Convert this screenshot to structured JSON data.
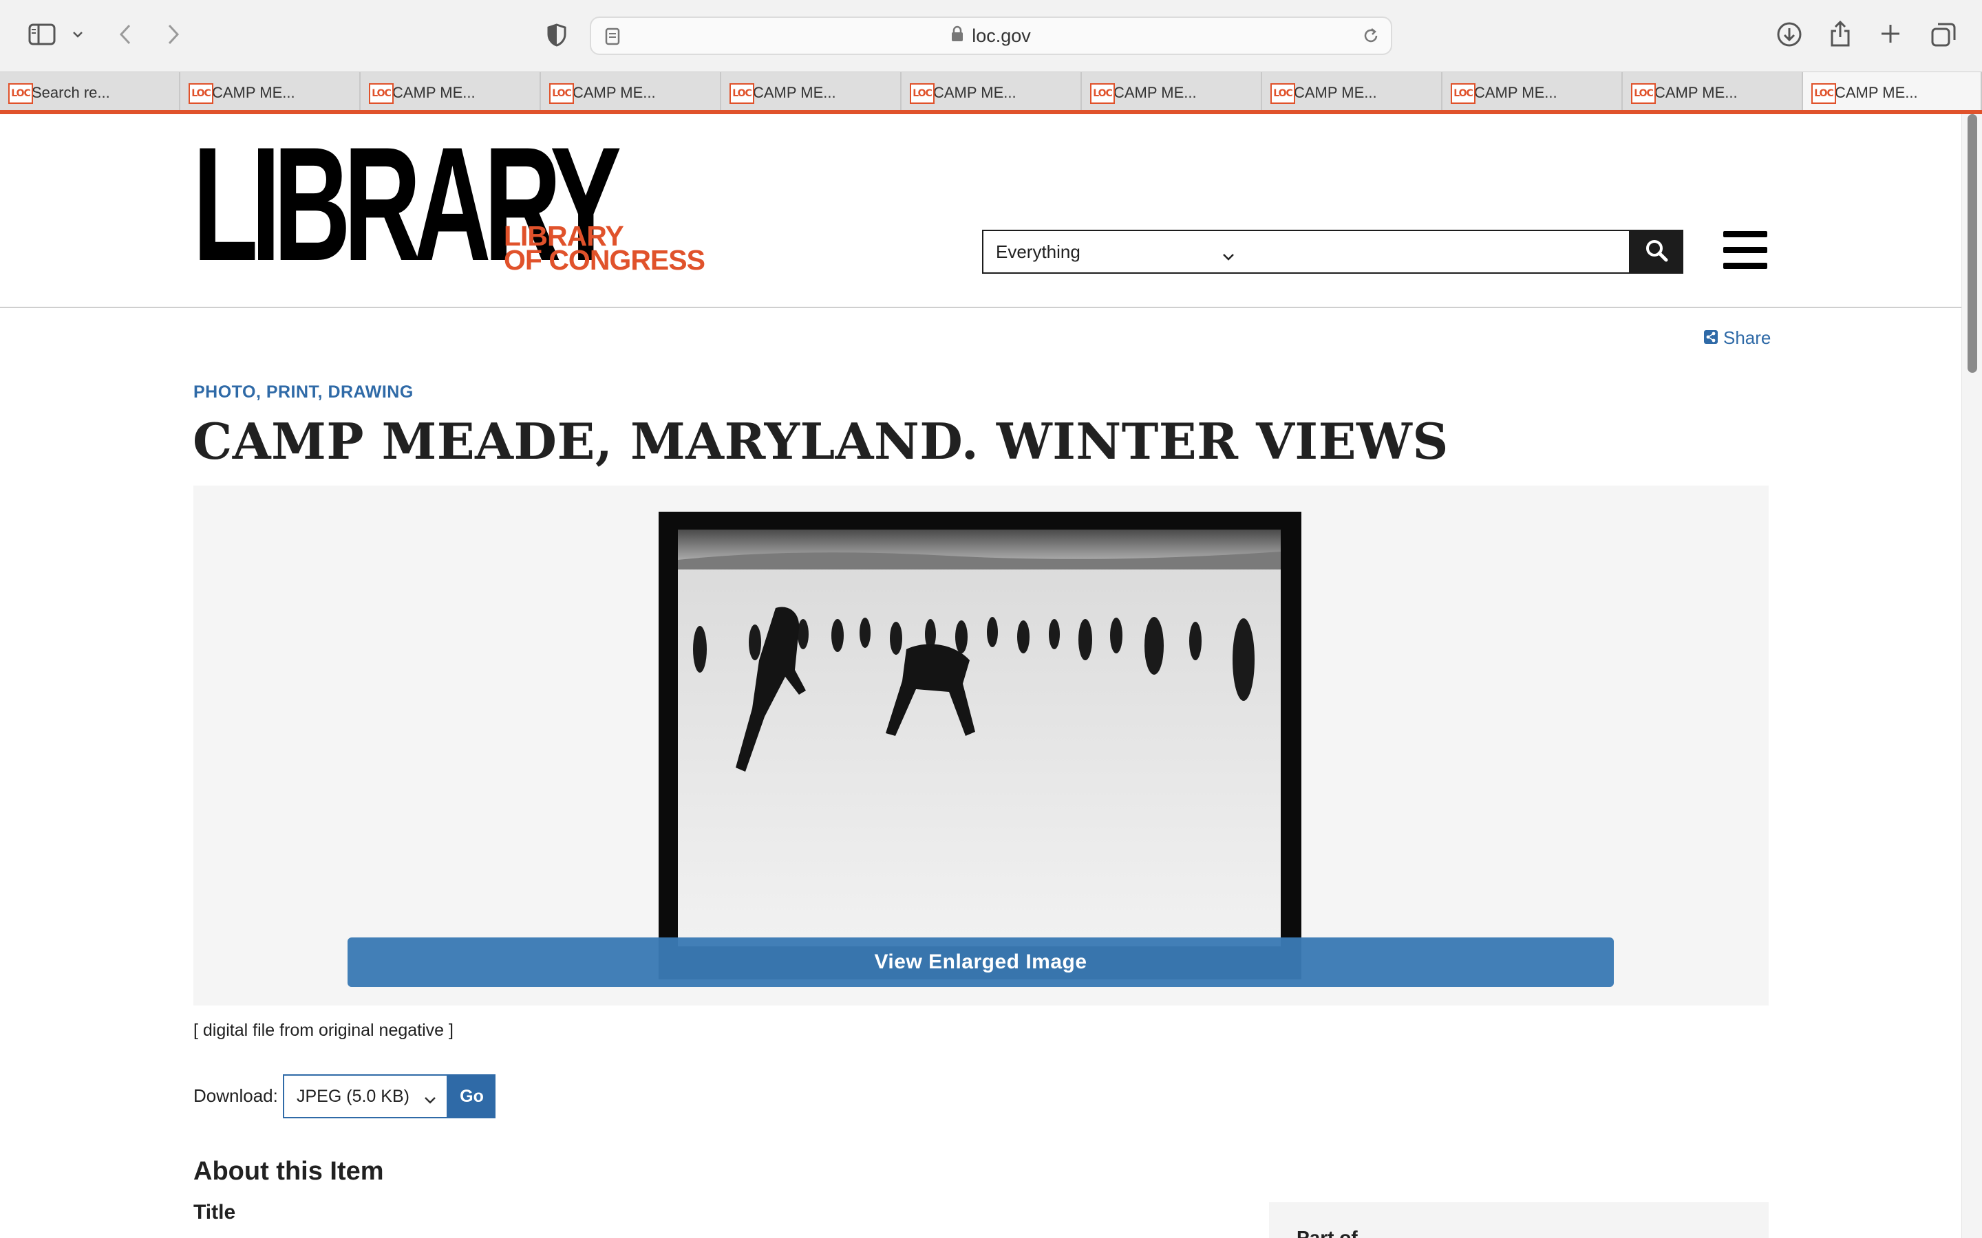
{
  "browser": {
    "url_host": "loc.gov",
    "tabs": [
      {
        "favicon": "LOC",
        "label": "Search re..."
      },
      {
        "favicon": "LOC",
        "label": "CAMP ME..."
      },
      {
        "favicon": "LOC",
        "label": "CAMP ME..."
      },
      {
        "favicon": "LOC",
        "label": "CAMP ME..."
      },
      {
        "favicon": "LOC",
        "label": "CAMP ME..."
      },
      {
        "favicon": "LOC",
        "label": "CAMP ME..."
      },
      {
        "favicon": "LOC",
        "label": "CAMP ME..."
      },
      {
        "favicon": "LOC",
        "label": "CAMP ME..."
      },
      {
        "favicon": "LOC",
        "label": "CAMP ME..."
      },
      {
        "favicon": "LOC",
        "label": "CAMP ME..."
      },
      {
        "favicon": "LOC",
        "label": "CAMP ME..."
      }
    ],
    "active_tab_index": 10,
    "icons": [
      "sidebar-icon",
      "chevron-down-icon",
      "back-icon",
      "forward-icon",
      "privacy-shield-icon",
      "reader-icon",
      "lock-icon",
      "reload-icon",
      "downloads-icon",
      "share-icon",
      "new-tab-icon",
      "tab-overview-icon"
    ]
  },
  "header": {
    "logo_word": "LIBRARY",
    "logo_sub_line1": "LIBRARY",
    "logo_sub_line2": "OF CONGRESS",
    "search_scope": "Everything",
    "search_value": "",
    "icons": [
      "search-icon",
      "menu-icon"
    ]
  },
  "item": {
    "share_label": "Share",
    "format": "PHOTO, PRINT, DRAWING",
    "title": "CAMP MEADE, MARYLAND. WINTER VIEWS",
    "view_button": "View Enlarged Image",
    "caption": "[ digital file from original negative ]",
    "download_label": "Download:",
    "download_option": "JPEG (5.0 KB)",
    "download_go": "Go",
    "about_heading": "About this Item",
    "field_title_label": "Title",
    "part_of_label": "Part of"
  },
  "colors": {
    "brand": "#e0522b",
    "link_blue": "#2f6aa7",
    "button_blue": "#3a7ab4",
    "text": "#212121"
  }
}
